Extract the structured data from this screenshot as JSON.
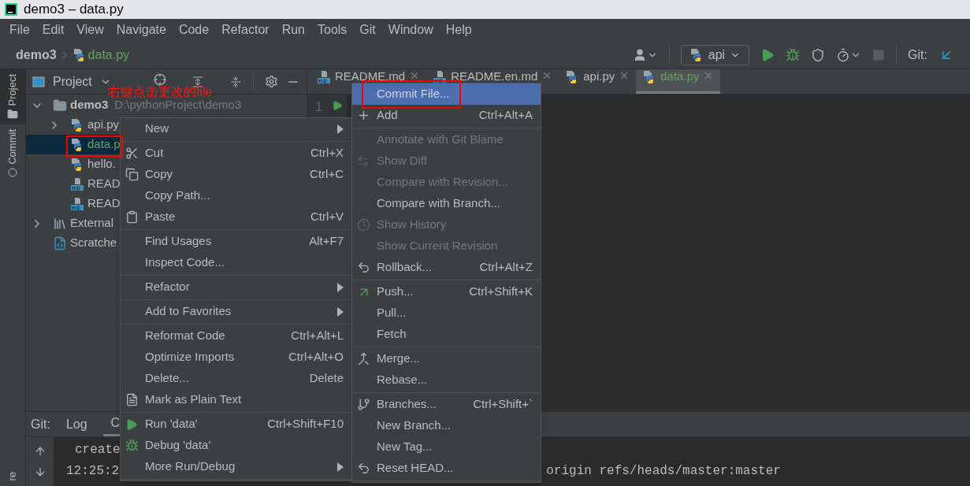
{
  "window": {
    "title": "demo3 – data.py"
  },
  "menu_bar": [
    "File",
    "Edit",
    "View",
    "Navigate",
    "Code",
    "Refactor",
    "Run",
    "Tools",
    "Git",
    "Window",
    "Help"
  ],
  "breadcrumb": {
    "project": "demo3",
    "file": "data.py"
  },
  "toolbar": {
    "run_config": "api",
    "git_label": "Git:"
  },
  "sidebar_tabs": [
    {
      "label": "Project",
      "selected": true
    },
    {
      "label": "Commit",
      "selected": false
    },
    {
      "label": "re",
      "selected": false
    }
  ],
  "project_panel": {
    "title": "Project"
  },
  "tree": [
    {
      "label": "demo3",
      "path": "D:\\pythonProject\\demo3",
      "kind": "folder",
      "expanded": true,
      "selected": false,
      "modified": false,
      "children": [
        {
          "label": "api.py",
          "kind": "python",
          "expanded": false,
          "selected": false,
          "modified": false
        },
        {
          "label": "data.p",
          "kind": "python",
          "selected": true,
          "modified": true
        },
        {
          "label": "hello.",
          "kind": "python",
          "selected": false,
          "modified": false
        },
        {
          "label": "READ",
          "kind": "markdown",
          "selected": false,
          "modified": false
        },
        {
          "label": "READ",
          "kind": "markdown",
          "selected": false,
          "modified": false
        }
      ]
    },
    {
      "label": "External",
      "kind": "library",
      "expanded": false,
      "selected": false,
      "modified": false
    },
    {
      "label": "Scratche",
      "kind": "scratch",
      "selected": false,
      "modified": false
    }
  ],
  "editor_tabs": [
    {
      "label": "README.md",
      "kind": "markdown",
      "selected": false,
      "modified": false
    },
    {
      "label": "README.en.md",
      "kind": "markdown",
      "selected": false,
      "modified": false
    },
    {
      "label": "api.py",
      "kind": "python",
      "selected": false,
      "modified": false
    },
    {
      "label": "data.py",
      "kind": "python",
      "selected": true,
      "modified": true
    }
  ],
  "gutter": {
    "line": "1"
  },
  "annotation": "右键点击更改的file",
  "context_menu": [
    {
      "kind": "item",
      "label": "New",
      "submenu": true
    },
    {
      "kind": "separator"
    },
    {
      "kind": "item",
      "label": "Cut",
      "shortcut": "Ctrl+X",
      "submenu": false
    },
    {
      "kind": "item",
      "label": "Copy",
      "shortcut": "Ctrl+C",
      "submenu": false
    },
    {
      "kind": "item",
      "label": "Copy Path...",
      "submenu": false
    },
    {
      "kind": "item",
      "label": "Paste",
      "shortcut": "Ctrl+V",
      "submenu": false
    },
    {
      "kind": "separator"
    },
    {
      "kind": "item",
      "label": "Find Usages",
      "shortcut": "Alt+F7",
      "submenu": false
    },
    {
      "kind": "item",
      "label": "Inspect Code...",
      "submenu": false
    },
    {
      "kind": "separator"
    },
    {
      "kind": "item",
      "label": "Refactor",
      "submenu": true
    },
    {
      "kind": "separator"
    },
    {
      "kind": "item",
      "label": "Add to Favorites",
      "submenu": true
    },
    {
      "kind": "separator"
    },
    {
      "kind": "item",
      "label": "Reformat Code",
      "shortcut": "Ctrl+Alt+L",
      "submenu": false
    },
    {
      "kind": "item",
      "label": "Optimize Imports",
      "shortcut": "Ctrl+Alt+O",
      "submenu": false
    },
    {
      "kind": "item",
      "label": "Delete...",
      "shortcut": "Delete",
      "submenu": false
    },
    {
      "kind": "item",
      "label": "Mark as Plain Text",
      "submenu": false
    },
    {
      "kind": "separator"
    },
    {
      "kind": "item",
      "label": "Run 'data'",
      "shortcut": "Ctrl+Shift+F10",
      "submenu": false
    },
    {
      "kind": "item",
      "label": "Debug 'data'",
      "submenu": false
    },
    {
      "kind": "item",
      "label": "More Run/Debug",
      "submenu": true
    },
    {
      "kind": "separator"
    }
  ],
  "git_submenu": [
    {
      "kind": "item",
      "label": "Commit File...",
      "selected": true,
      "disabled": false
    },
    {
      "kind": "item",
      "label": "Add",
      "shortcut": "Ctrl+Alt+A",
      "selected": false,
      "disabled": false
    },
    {
      "kind": "separator"
    },
    {
      "kind": "item",
      "label": "Annotate with Git Blame",
      "selected": false,
      "disabled": true
    },
    {
      "kind": "item",
      "label": "Show Diff",
      "selected": false,
      "disabled": true
    },
    {
      "kind": "item",
      "label": "Compare with Revision...",
      "selected": false,
      "disabled": true
    },
    {
      "kind": "item",
      "label": "Compare with Branch...",
      "selected": false,
      "disabled": false
    },
    {
      "kind": "item",
      "label": "Show History",
      "selected": false,
      "disabled": true
    },
    {
      "kind": "item",
      "label": "Show Current Revision",
      "selected": false,
      "disabled": true
    },
    {
      "kind": "item",
      "label": "Rollback...",
      "shortcut": "Ctrl+Alt+Z",
      "selected": false,
      "disabled": false
    },
    {
      "kind": "separator"
    },
    {
      "kind": "item",
      "label": "Push...",
      "shortcut": "Ctrl+Shift+K",
      "selected": false,
      "disabled": false
    },
    {
      "kind": "item",
      "label": "Pull...",
      "selected": false,
      "disabled": false
    },
    {
      "kind": "item",
      "label": "Fetch",
      "selected": false,
      "disabled": false
    },
    {
      "kind": "separator"
    },
    {
      "kind": "item",
      "label": "Merge...",
      "selected": false,
      "disabled": false
    },
    {
      "kind": "item",
      "label": "Rebase...",
      "selected": false,
      "disabled": false
    },
    {
      "kind": "separator"
    },
    {
      "kind": "item",
      "label": "Branches...",
      "shortcut": "Ctrl+Shift+`",
      "selected": false,
      "disabled": false
    },
    {
      "kind": "item",
      "label": "New Branch...",
      "selected": false,
      "disabled": false
    },
    {
      "kind": "item",
      "label": "New Tag...",
      "selected": false,
      "disabled": false
    },
    {
      "kind": "item",
      "label": "Reset HEAD...",
      "selected": false,
      "disabled": false
    },
    {
      "kind": "separator"
    }
  ],
  "bottom_panel": {
    "title": "Git:",
    "tabs": [
      {
        "label": "Log",
        "selected": false
      },
      {
        "label": "C",
        "selected": true
      }
    ],
    "console": [
      {
        "text": "create"
      },
      {
        "text": "12:25:2",
        "tail": "origin refs/heads/master:master"
      }
    ]
  }
}
